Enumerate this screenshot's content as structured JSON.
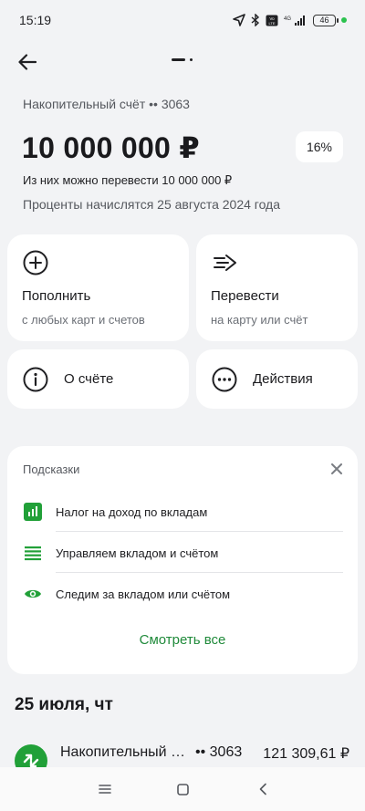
{
  "status_bar": {
    "time": "15:19",
    "battery": "46",
    "icons": [
      "location-arrow-icon",
      "bluetooth-icon",
      "volte-icon",
      "signal-4g-icon",
      "battery-icon"
    ]
  },
  "header": {
    "back_icon": "arrow-left-icon"
  },
  "account": {
    "label": "Накопительный счёт •• 3063",
    "balance": "10 000 000 ₽",
    "rate": "16%",
    "transferable": "Из них можно перевести 10 000 000 ₽",
    "interest_note": "Проценты начислятся 25 августа 2024 года"
  },
  "actions": {
    "topup": {
      "title": "Пополнить",
      "subtitle": "с любых карт и счетов",
      "icon": "plus-circle-icon"
    },
    "transfer": {
      "title": "Перевести",
      "subtitle": "на карту или счёт",
      "icon": "send-arrow-icon"
    },
    "about": {
      "title": "О счёте",
      "icon": "info-circle-icon"
    },
    "more": {
      "title": "Действия",
      "icon": "more-dots-icon"
    }
  },
  "tips": {
    "title": "Подсказки",
    "items": [
      {
        "label": "Налог на доход по вкладам",
        "icon": "chart-icon"
      },
      {
        "label": "Управляем вкладом и счётом",
        "icon": "list-icon"
      },
      {
        "label": "Следим за вкладом или счётом",
        "icon": "eye-icon"
      }
    ],
    "see_all": "Смотреть все"
  },
  "history": {
    "date": "25 июля, чт",
    "transactions": [
      {
        "name": "Накопительный счёт",
        "account": "•• 3063",
        "amount": "121 309,61 ₽"
      }
    ]
  },
  "colors": {
    "accent": "#1f8a3a",
    "brand_green": "#21a038",
    "background": "#f2f3f5"
  }
}
